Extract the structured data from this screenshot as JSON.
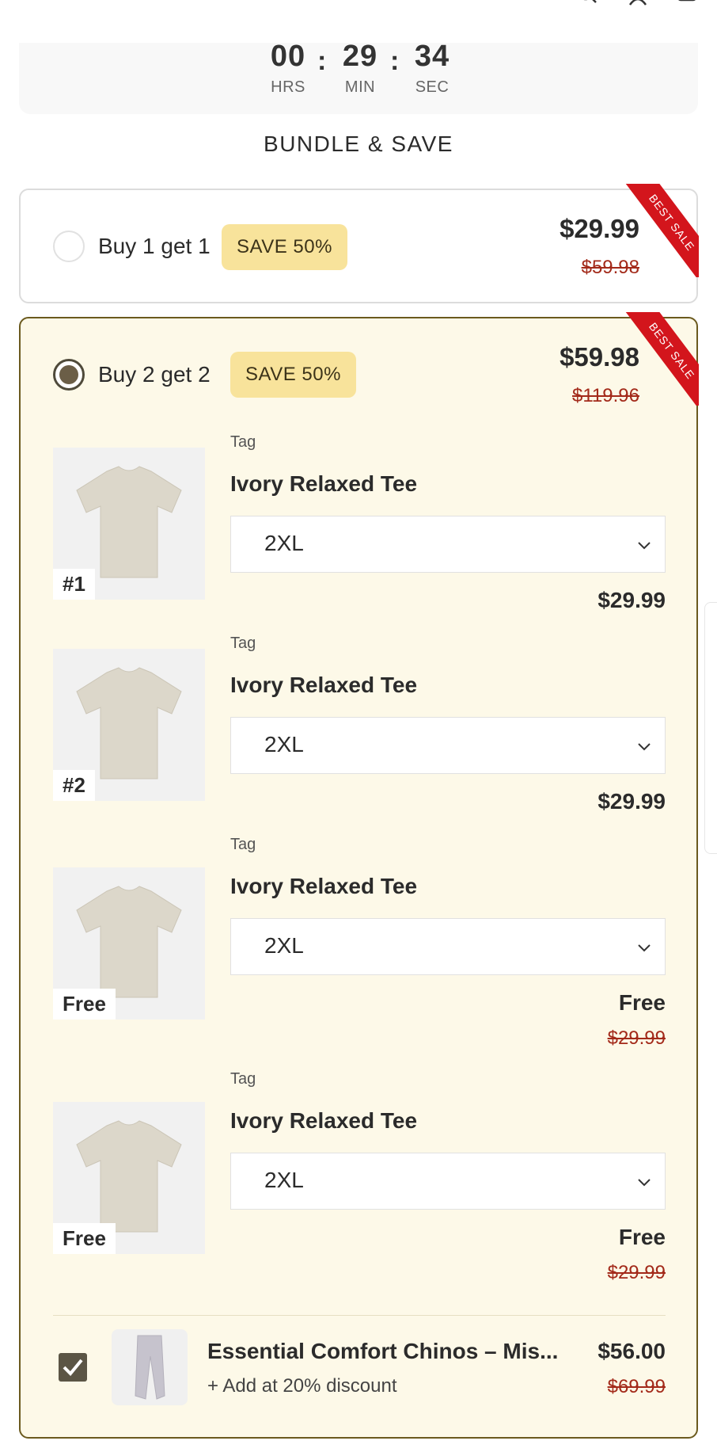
{
  "timer": {
    "hours": "00",
    "hours_unit": "HRS",
    "minutes": "29",
    "minutes_unit": "MIN",
    "seconds": "34",
    "seconds_unit": "SEC",
    "separator": ":"
  },
  "section_title": "BUNDLE & SAVE",
  "offers": [
    {
      "label": "Buy 1 get 1",
      "badge": "SAVE 50%",
      "price": "$29.99",
      "old_price": "$59.98",
      "ribbon": "BEST SALE",
      "selected": false
    },
    {
      "label": "Buy 2 get 2",
      "badge": "SAVE 50%",
      "price": "$59.98",
      "old_price": "$119.96",
      "ribbon": "BEST SALE",
      "selected": true,
      "items": [
        {
          "thumb_tag": "#1",
          "tag": "Tag",
          "name": "Ivory Relaxed Tee",
          "size": "2XL",
          "price": "$29.99",
          "old_price": ""
        },
        {
          "thumb_tag": "#2",
          "tag": "Tag",
          "name": "Ivory Relaxed Tee",
          "size": "2XL",
          "price": "$29.99",
          "old_price": ""
        },
        {
          "thumb_tag": "Free",
          "tag": "Tag",
          "name": "Ivory Relaxed Tee",
          "size": "2XL",
          "price": "Free",
          "old_price": "$29.99"
        },
        {
          "thumb_tag": "Free",
          "tag": "Tag",
          "name": "Ivory Relaxed Tee",
          "size": "2XL",
          "price": "Free",
          "old_price": "$29.99"
        }
      ],
      "addon": {
        "checked": true,
        "name": "Essential Comfort Chinos – Mis...",
        "subtitle": "+ Add at 20% discount",
        "price": "$56.00",
        "old_price": "$69.99"
      }
    }
  ],
  "colors": {
    "selected_border": "#6b5a1e",
    "selected_bg": "#fdf9e8",
    "badge_bg": "#f8e39b",
    "ribbon": "#d3151c",
    "strike_price": "#a32a1a"
  }
}
